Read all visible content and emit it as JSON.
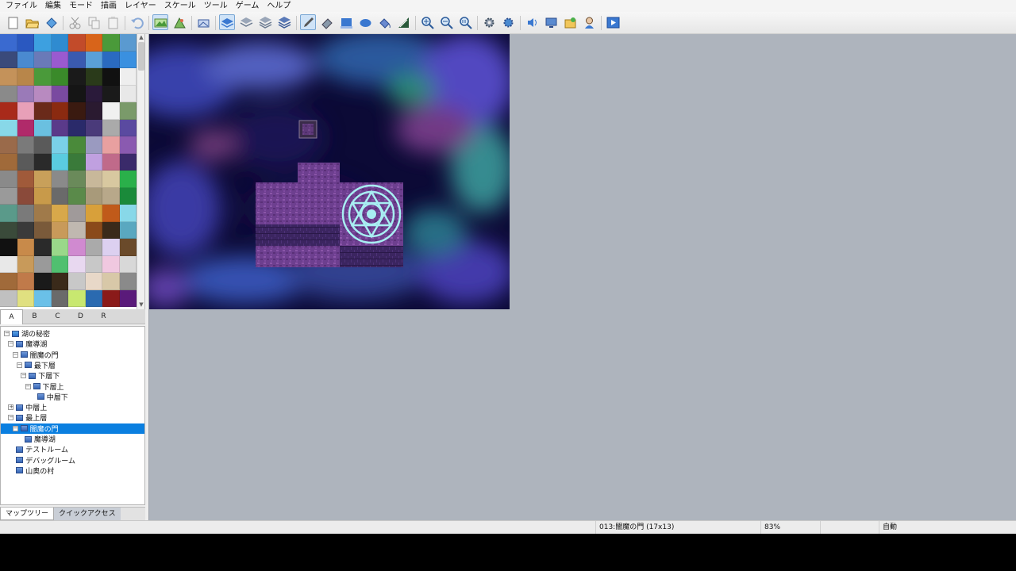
{
  "menu": [
    "ファイル",
    "編集",
    "モード",
    "描画",
    "レイヤー",
    "スケール",
    "ツール",
    "ゲーム",
    "ヘルプ"
  ],
  "toolbar": {
    "groups": [
      [
        {
          "name": "new-project",
          "icon": "new-page-icon"
        },
        {
          "name": "open-project",
          "icon": "open-folder-icon"
        },
        {
          "name": "save-project",
          "icon": "save-icon"
        }
      ],
      [
        {
          "name": "cut",
          "icon": "scissors-icon"
        },
        {
          "name": "copy",
          "icon": "copy-icon"
        },
        {
          "name": "paste",
          "icon": "paste-icon"
        }
      ],
      [
        {
          "name": "undo",
          "icon": "undo-icon"
        }
      ],
      [
        {
          "name": "mode-map",
          "icon": "map-mode-icon",
          "active": true
        },
        {
          "name": "mode-region",
          "icon": "region-mode-icon"
        }
      ],
      [
        {
          "name": "mode-event",
          "icon": "event-mode-icon"
        }
      ],
      [
        {
          "name": "layer-1",
          "icon": "layer-1-icon",
          "active": true
        },
        {
          "name": "layer-2",
          "icon": "layer-2-icon"
        },
        {
          "name": "layer-3",
          "icon": "layer-3-icon"
        },
        {
          "name": "layer-4",
          "icon": "layer-4-icon"
        }
      ],
      [
        {
          "name": "pencil",
          "icon": "pencil-icon",
          "active": true
        },
        {
          "name": "eraser",
          "icon": "eraser-icon"
        },
        {
          "name": "rectangle",
          "icon": "rectangle-icon"
        },
        {
          "name": "ellipse",
          "icon": "ellipse-icon"
        },
        {
          "name": "fill",
          "icon": "fill-icon"
        },
        {
          "name": "shadow-pen",
          "icon": "shadow-pen-icon"
        }
      ],
      [
        {
          "name": "zoom-in",
          "icon": "zoom-in-icon"
        },
        {
          "name": "zoom-out",
          "icon": "zoom-out-icon"
        },
        {
          "name": "zoom-actual",
          "icon": "zoom-actual-icon"
        }
      ],
      [
        {
          "name": "database",
          "icon": "gear-database-icon"
        },
        {
          "name": "plugin-manager",
          "icon": "plugin-icon"
        }
      ],
      [
        {
          "name": "sound-test",
          "icon": "speaker-icon"
        },
        {
          "name": "event-searcher",
          "icon": "monitor-icon"
        },
        {
          "name": "resource-manager",
          "icon": "resource-icon"
        },
        {
          "name": "character-generator",
          "icon": "character-icon"
        }
      ],
      [
        {
          "name": "playtest",
          "icon": "play-icon"
        }
      ]
    ]
  },
  "tileset_tabs": [
    {
      "label": "A",
      "selected": true
    },
    {
      "label": "B",
      "selected": false
    },
    {
      "label": "C",
      "selected": false
    },
    {
      "label": "D",
      "selected": false
    },
    {
      "label": "R",
      "selected": false
    }
  ],
  "map_tree": [
    {
      "label": "湖の秘密",
      "depth": 0,
      "expand": "minus",
      "root": true
    },
    {
      "label": "魔導湖",
      "depth": 1,
      "expand": "minus"
    },
    {
      "label": "闇魔の門",
      "depth": 2,
      "expand": "minus"
    },
    {
      "label": "最下層",
      "depth": 3,
      "expand": "minus"
    },
    {
      "label": "下層下",
      "depth": 4,
      "expand": "minus"
    },
    {
      "label": "下層上",
      "depth": 5,
      "expand": "minus"
    },
    {
      "label": "中層下",
      "depth": 6,
      "expand": ""
    },
    {
      "label": "中層上",
      "depth": 1,
      "expand": "plus"
    },
    {
      "label": "最上層",
      "depth": 1,
      "expand": "minus"
    },
    {
      "label": "闇魔の門",
      "depth": 2,
      "expand": "minus",
      "selected": true
    },
    {
      "label": "魔導湖",
      "depth": 3,
      "expand": ""
    },
    {
      "label": "テストルーム",
      "depth": 1,
      "expand": ""
    },
    {
      "label": "デバッグルーム",
      "depth": 1,
      "expand": ""
    },
    {
      "label": "山奥の村",
      "depth": 1,
      "expand": ""
    }
  ],
  "bottom_tabs": [
    {
      "label": "マップツリー",
      "selected": true
    },
    {
      "label": "クイックアクセス",
      "selected": false
    }
  ],
  "status": {
    "map": "013:闇魔の門 (17x13)",
    "zoom": "83%",
    "auto": "自動"
  },
  "colors": {
    "selection": "#0a7fe0",
    "canvas_bg": "#aeb4bd",
    "floor": "#6a3f8e",
    "magic_circle": "#9fe3ea"
  }
}
